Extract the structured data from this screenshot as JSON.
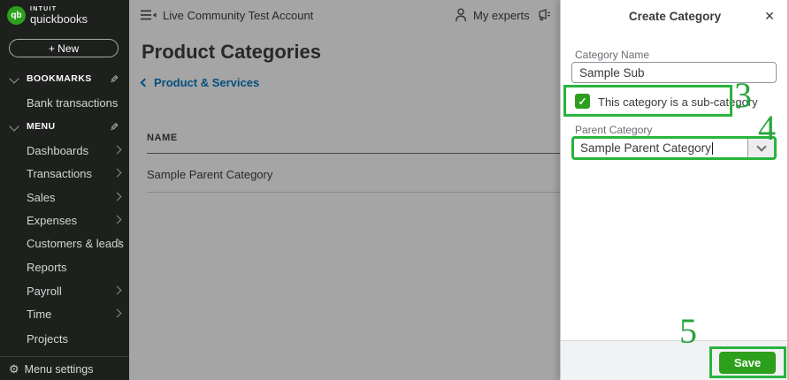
{
  "sidebar": {
    "brand": {
      "monogram": "qb",
      "intuit": "INTUIT",
      "quickbooks": "quickbooks"
    },
    "new_button_label": "+ New",
    "sections": [
      {
        "label": "BOOKMARKS"
      },
      {
        "label": "MENU"
      }
    ],
    "bookmarks_items": [
      {
        "label": "Bank transactions"
      }
    ],
    "menu_items": [
      {
        "label": "Dashboards"
      },
      {
        "label": "Transactions"
      },
      {
        "label": "Sales"
      },
      {
        "label": "Expenses"
      },
      {
        "label": "Customers & leads"
      },
      {
        "label": "Reports"
      },
      {
        "label": "Payroll"
      },
      {
        "label": "Time"
      },
      {
        "label": "Projects"
      }
    ],
    "menu_settings_label": "Menu settings"
  },
  "header": {
    "account_name": "Live Community Test Account",
    "my_experts_label": "My experts"
  },
  "main": {
    "page_title": "Product Categories",
    "breadcrumb_label": "Product & Services",
    "table": {
      "columns": [
        "NAME"
      ],
      "rows": [
        {
          "name": "Sample Parent Category"
        }
      ]
    }
  },
  "drawer": {
    "title": "Create Category",
    "category_name": {
      "label": "Category Name",
      "value": "Sample Sub"
    },
    "subcategory_checkbox": {
      "label": "This category is a sub-category",
      "checked": true
    },
    "parent_category": {
      "label": "Parent Category",
      "value": "Sample Parent Category"
    },
    "save_button_label": "Save"
  },
  "annotations": {
    "step_3": "3",
    "step_4": "4",
    "step_5": "5",
    "highlight_color": "#28b43e"
  }
}
